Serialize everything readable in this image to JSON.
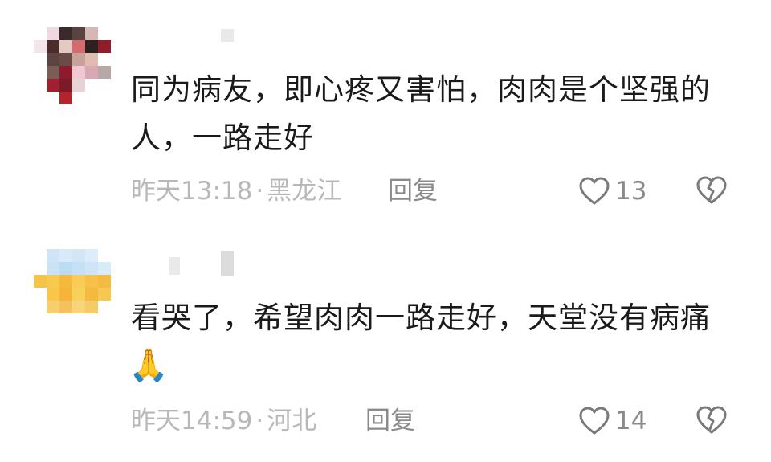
{
  "comments": [
    {
      "text": "同为病友，即心疼又害怕，肉肉是个坚强的人，一路走好",
      "emoji": "",
      "time": "昨天13:18",
      "separator": "·",
      "location": "黑龙江",
      "reply_label": "回复",
      "likes": "13",
      "like_icon": "heart-outline-icon",
      "dislike_icon": "broken-heart-icon"
    },
    {
      "text": "看哭了，希望肉肉一路走好，天堂没有病痛",
      "emoji": "🙏",
      "time": "昨天14:59",
      "separator": "·",
      "location": "河北",
      "reply_label": "回复",
      "likes": "14",
      "like_icon": "heart-outline-icon",
      "dislike_icon": "broken-heart-icon"
    }
  ],
  "colors": {
    "text": "#1a1a1a",
    "meta": "#b8b8b8",
    "action": "#8a8a8a",
    "icon_stroke": "#7a7a7a"
  }
}
